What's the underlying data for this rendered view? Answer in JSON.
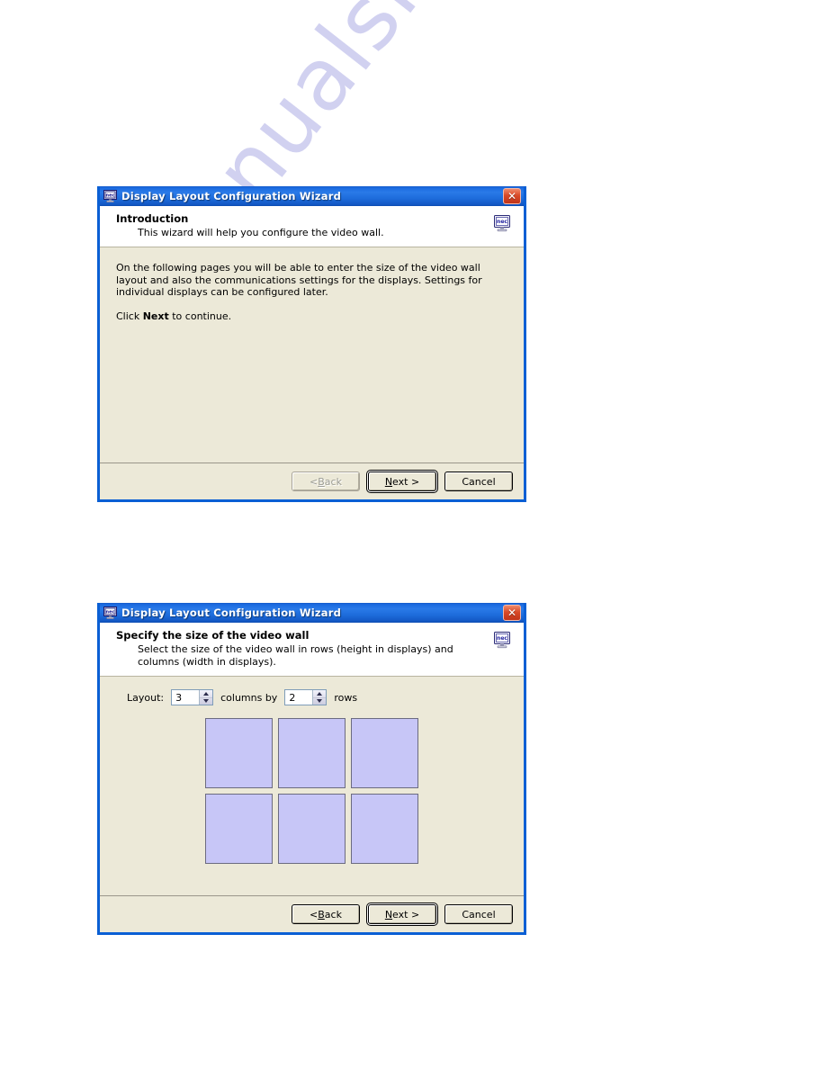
{
  "page": {
    "background_color": "#ffffff",
    "watermark_text": "manualshive.com",
    "watermark_color": "#c9c9ee"
  },
  "colors": {
    "titlebar_blue": "#1b6ae0",
    "dialog_border_blue": "#0a5fd4",
    "dialog_face": "#ece9d8",
    "tile_fill": "#c7c6f7",
    "tile_border": "#6b6b80",
    "close_red": "#d94a28"
  },
  "dialog1": {
    "titlebar": {
      "icon": "nec-monitor-icon",
      "title": "Display Layout Configuration Wizard",
      "close_label": "✕"
    },
    "header": {
      "title": "Introduction",
      "subtitle": "This wizard will help you configure the video wall.",
      "icon": "nec-monitor-icon"
    },
    "body": {
      "paragraph1": "On the following pages you will be able to enter the size of the video wall layout and also the communications settings for the displays. Settings for individual displays can be configured later.",
      "paragraph2_prefix": "Click ",
      "paragraph2_bold": "Next",
      "paragraph2_suffix": " to continue."
    },
    "footer": {
      "back_label": "< Back",
      "back_disabled": true,
      "next_label_prefix": "",
      "next_label": "Next >",
      "next_default": true,
      "cancel_label": "Cancel"
    }
  },
  "dialog2": {
    "titlebar": {
      "icon": "nec-monitor-icon",
      "title": "Display Layout Configuration Wizard",
      "close_label": "✕"
    },
    "header": {
      "title": "Specify the size of the video wall",
      "subtitle": "Select the size of the video wall in rows (height in displays) and columns (width in displays).",
      "icon": "nec-monitor-icon"
    },
    "layout": {
      "label": "Layout:",
      "columns_value": "3",
      "middle_label": "columns by",
      "rows_value": "2",
      "trailing_label": "rows",
      "columns": 3,
      "rows": 2,
      "tile_count": 6
    },
    "footer": {
      "back_label": "< Back",
      "back_disabled": false,
      "next_label": "Next >",
      "next_default": true,
      "cancel_label": "Cancel"
    }
  }
}
